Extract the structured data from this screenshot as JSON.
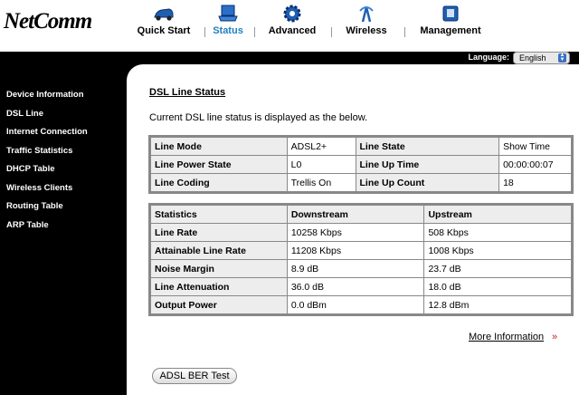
{
  "brand": {
    "logo_text": "NetComm"
  },
  "nav": {
    "items": [
      {
        "label": "Quick Start",
        "icon": "car-icon",
        "active": false
      },
      {
        "label": "Status",
        "icon": "laptop-icon",
        "active": true
      },
      {
        "label": "Advanced",
        "icon": "gear-icon",
        "active": false
      },
      {
        "label": "Wireless",
        "icon": "wireless-icon",
        "active": false
      },
      {
        "label": "Management",
        "icon": "management-icon",
        "active": false
      }
    ]
  },
  "language": {
    "label": "Language:",
    "selected": "English"
  },
  "sidebar": {
    "items": [
      {
        "label": "Device Information"
      },
      {
        "label": "DSL Line"
      },
      {
        "label": "Internet Connection"
      },
      {
        "label": "Traffic Statistics"
      },
      {
        "label": "DHCP Table"
      },
      {
        "label": "Wireless Clients"
      },
      {
        "label": "Routing Table"
      },
      {
        "label": "ARP Table"
      }
    ]
  },
  "main": {
    "title": "DSL Line Status",
    "description": "Current DSL line status is displayed as the below.",
    "line_table": {
      "rows": [
        {
          "label1": "Line Mode",
          "value1": "ADSL2+",
          "label2": "Line State",
          "value2": "Show Time"
        },
        {
          "label1": "Line Power State",
          "value1": "L0",
          "label2": "Line Up Time",
          "value2": "00:00:00:07"
        },
        {
          "label1": "Line Coding",
          "value1": "Trellis On",
          "label2": "Line Up Count",
          "value2": "18"
        }
      ]
    },
    "stats_table": {
      "headers": [
        "Statistics",
        "Downstream",
        "Upstream"
      ],
      "rows": [
        {
          "label": "Line Rate",
          "down": "10258 Kbps",
          "up": "508 Kbps"
        },
        {
          "label": "Attainable Line Rate",
          "down": "11208 Kbps",
          "up": "1008 Kbps"
        },
        {
          "label": "Noise Margin",
          "down": "8.9 dB",
          "up": "23.7 dB"
        },
        {
          "label": "Line Attenuation",
          "down": "36.0 dB",
          "up": "18.0 dB"
        },
        {
          "label": "Output Power",
          "down": "0.0 dBm",
          "up": "12.8 dBm"
        }
      ]
    },
    "more_info_label": "More Information",
    "ber_button_label": "ADSL BER Test"
  }
}
